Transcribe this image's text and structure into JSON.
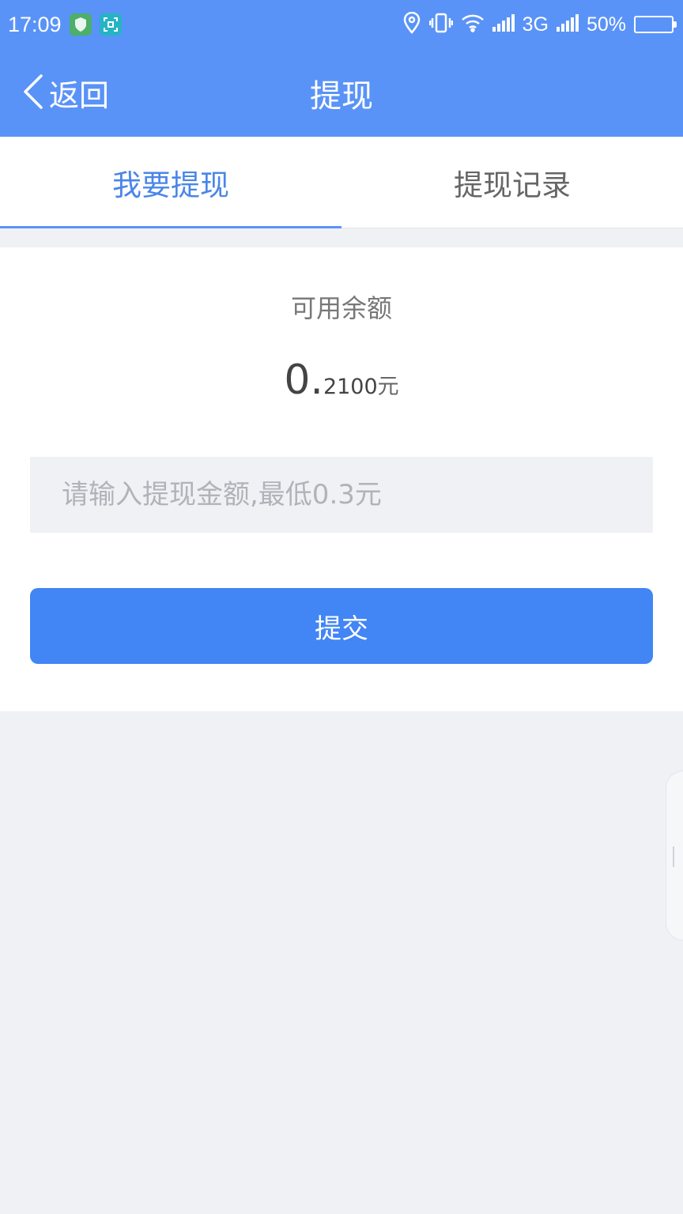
{
  "status_bar": {
    "time": "17:09",
    "network": "3G",
    "battery": "50%",
    "battery_level": 0.5,
    "icons": [
      "shield-app-icon",
      "scan-app-icon",
      "location-icon",
      "vibrate-icon",
      "wifi-icon",
      "signal-icon"
    ]
  },
  "nav": {
    "back_label": "返回",
    "title": "提现"
  },
  "tabs": [
    {
      "label": "我要提现",
      "active": true
    },
    {
      "label": "提现记录",
      "active": false
    }
  ],
  "balance": {
    "label": "可用余额",
    "integer": "0.",
    "decimal": "2100",
    "unit": "元"
  },
  "amount_input": {
    "value": "",
    "placeholder": "请输入提现金额,最低0.3元"
  },
  "submit_label": "提交",
  "colors": {
    "header": "#5a93f7",
    "button": "#4285f4",
    "tab_active": "#4a86e8",
    "background": "#eff1f5"
  }
}
